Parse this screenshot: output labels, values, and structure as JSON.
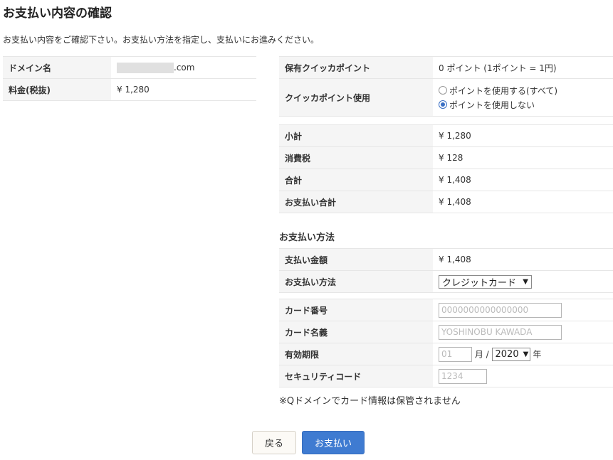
{
  "page": {
    "title": "お支払い内容の確認",
    "intro": "お支払い内容をご確認下さい。お支払い方法を指定し、支払いにお進みください。"
  },
  "domain": {
    "name_label": "ドメイン名",
    "name_suffix": ".com",
    "fee_label": "料金(税抜)",
    "fee_value": "¥ 1,280"
  },
  "points": {
    "held_label": "保有クイッカポイント",
    "held_value": "0 ポイント (1ポイント = 1円)",
    "use_label": "クイッカポイント使用",
    "options": [
      {
        "label": "ポイントを使用する(すべて)",
        "selected": false
      },
      {
        "label": "ポイントを使用しない",
        "selected": true
      }
    ]
  },
  "totals": {
    "subtotal_label": "小計",
    "subtotal_value": "¥ 1,280",
    "tax_label": "消費税",
    "tax_value": "¥ 128",
    "total_label": "合計",
    "total_value": "¥ 1,408",
    "payment_total_label": "お支払い合計",
    "payment_total_value": "¥ 1,408"
  },
  "payment": {
    "section_title": "お支払い方法",
    "amount_label": "支払い金額",
    "amount_value": "¥ 1,408",
    "method_label": "お支払い方法",
    "method_selected": "クレジットカード"
  },
  "card": {
    "number_label": "カード番号",
    "number_placeholder": "0000000000000000",
    "holder_label": "カード名義",
    "holder_placeholder": "YOSHINOBU KAWADA",
    "expiry_label": "有効期限",
    "month_placeholder": "01",
    "month_unit": "月 /",
    "year_selected": "2020",
    "year_unit": "年",
    "security_label": "セキュリティコード",
    "security_placeholder": "1234"
  },
  "note": "※Qドメインでカード情報は保管されません",
  "buttons": {
    "back": "戻る",
    "pay": "お支払い"
  },
  "colors": {
    "primary": "#3f7bd1",
    "radio_selected": "#3a6fc4",
    "key_bg": "#f5f5f5"
  }
}
